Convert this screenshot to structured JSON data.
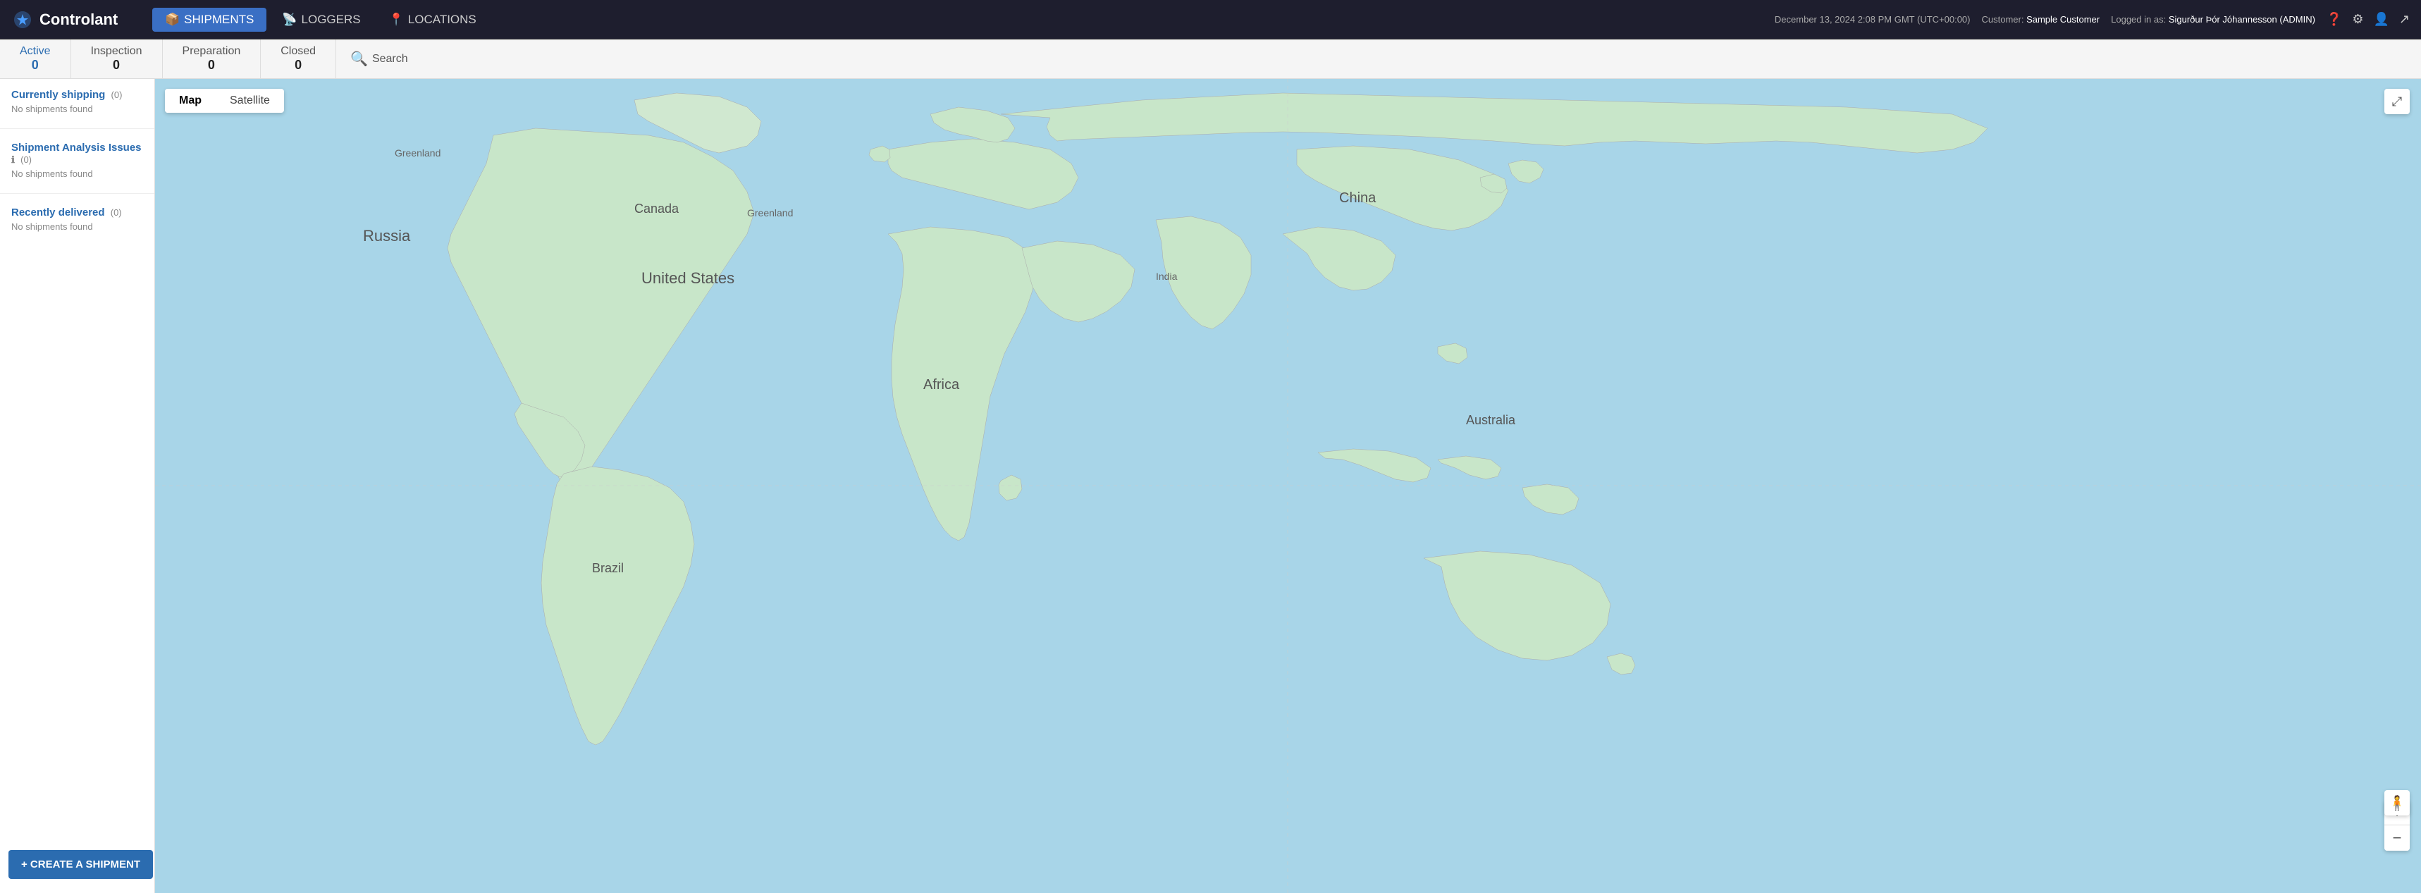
{
  "topnav": {
    "logo_text": "Controlant",
    "nav_items": [
      {
        "id": "shipments",
        "label": "SHIPMENTS",
        "active": true,
        "icon": "📦"
      },
      {
        "id": "loggers",
        "label": "LOGGERS",
        "active": false,
        "icon": "📡"
      },
      {
        "id": "locations",
        "label": "LOCATIONS",
        "active": false,
        "icon": "📍"
      }
    ],
    "datetime": "December 13, 2024 2:08 PM GMT (UTC+00:00)",
    "customer_label": "Customer:",
    "customer_name": "Sample Customer",
    "logged_in_label": "Logged in as:",
    "user_name": "Sigurður Þór Jóhannesson (ADMIN)"
  },
  "statusbar": {
    "tabs": [
      {
        "id": "active",
        "label": "Active",
        "count": "0",
        "active": true
      },
      {
        "id": "inspection",
        "label": "Inspection",
        "count": "0",
        "active": false
      },
      {
        "id": "preparation",
        "label": "Preparation",
        "count": "0",
        "active": false
      },
      {
        "id": "closed",
        "label": "Closed",
        "count": "0",
        "active": false
      },
      {
        "id": "search",
        "label": "Search",
        "is_search": true
      }
    ]
  },
  "sidebar": {
    "currently_shipping": {
      "title": "Currently shipping",
      "count": "(0)",
      "empty_msg": "No shipments found"
    },
    "analysis_issues": {
      "title": "Shipment Analysis Issues",
      "count": "(0)",
      "empty_msg": "No shipments found"
    },
    "recently_delivered": {
      "title": "Recently delivered",
      "count": "(0)",
      "empty_msg": "No shipments found"
    },
    "create_btn": "+ CREATE A SHIPMENT"
  },
  "map": {
    "toggle_map": "Map",
    "toggle_satellite": "Satellite",
    "zoom_in": "+",
    "zoom_out": "−"
  }
}
